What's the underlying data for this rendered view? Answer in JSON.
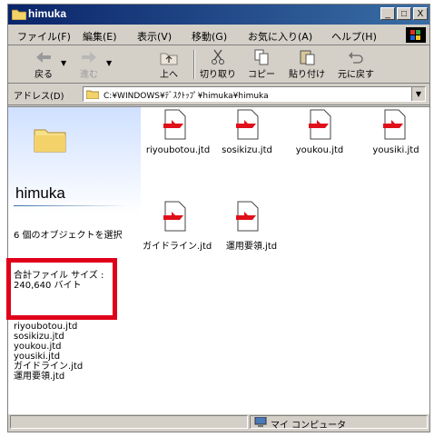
{
  "window": {
    "title": "himuka",
    "buttons": [
      "_",
      "□",
      "X"
    ]
  },
  "menu": [
    "ファイル(F)",
    "編集(E)",
    "表示(V)",
    "移動(G)",
    "お気に入り(A)",
    "ヘルプ(H)"
  ],
  "toolbar": [
    {
      "label": "戻る",
      "icon": "back-arrow-icon"
    },
    {
      "label": "進む",
      "icon": "forward-arrow-icon"
    },
    {
      "label": "上へ",
      "icon": "up-folder-icon"
    },
    {
      "label": "切り取り",
      "icon": "scissors-icon"
    },
    {
      "label": "コピー",
      "icon": "copy-icon"
    },
    {
      "label": "貼り付け",
      "icon": "paste-icon"
    },
    {
      "label": "元に戻す",
      "icon": "undo-icon"
    }
  ],
  "address": {
    "label": "アドレス(D)",
    "path": "C:¥WINDOWS¥ﾃﾞｽｸﾄｯﾌﾟ¥himuka¥himuka"
  },
  "left_panel": {
    "folder_name": "himuka",
    "selection": "6 個のオブジェクトを選択",
    "total_size": "合計ファイル サイズ : 240,640 バイト",
    "selected_files": [
      "riyoubotou.jtd",
      "sosikizu.jtd",
      "youkou.jtd",
      "yousiki.jtd",
      "ガイドライン.jtd",
      "運用要領.jtd"
    ]
  },
  "files": [
    "riyoubotou.jtd",
    "sosikizu.jtd",
    "youkou.jtd",
    "yousiki.jtd",
    "ガイドライン.jtd",
    "運用要領.jtd"
  ],
  "status": {
    "text": "マイ コンピュータ"
  },
  "colors": {
    "titlebar": "#0a246a",
    "highlight": "#e0001a",
    "file_icon_accent": "#e0101a"
  }
}
